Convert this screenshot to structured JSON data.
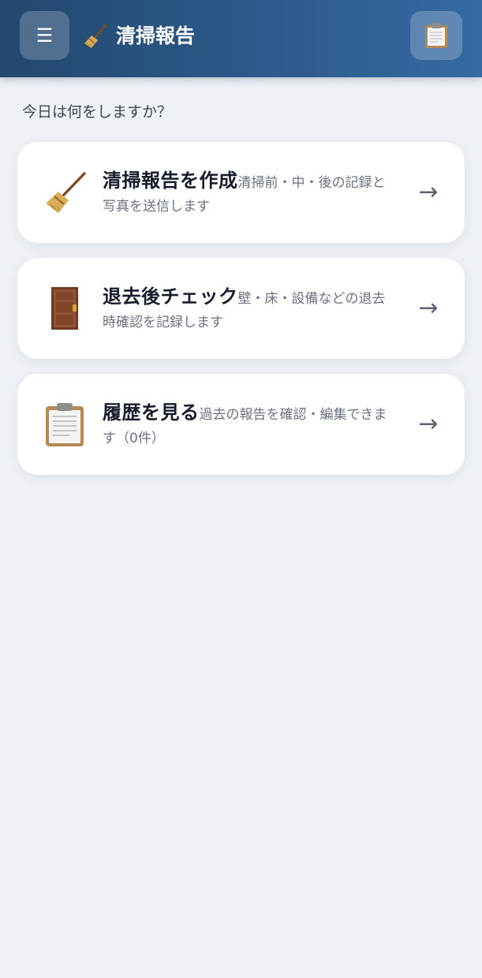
{
  "header": {
    "menu_icon": "hamburger-icon",
    "title_icon": "broom-icon",
    "title": "清掃報告",
    "history_icon": "clipboard-icon"
  },
  "prompt": "今日は何をしますか？",
  "cards": [
    {
      "icon": "broom-icon",
      "title": "清掃報告を作成",
      "description": "清掃前・中・後の記録と写真を送信します",
      "arrow": "→"
    },
    {
      "icon": "door-icon",
      "title": "退去後チェック",
      "description": "壁・床・設備などの退去時確認を記録します",
      "arrow": "→"
    },
    {
      "icon": "clipboard-icon",
      "title": "履歴を見る",
      "description": "過去の報告を確認・編集できます（0件）",
      "arrow": "→"
    }
  ],
  "colors": {
    "header_start": "#24486f",
    "header_end": "#356aa3",
    "background": "#eef2f6",
    "card": "#ffffff",
    "title_text": "#161c2d",
    "desc_text": "#6a7281"
  }
}
